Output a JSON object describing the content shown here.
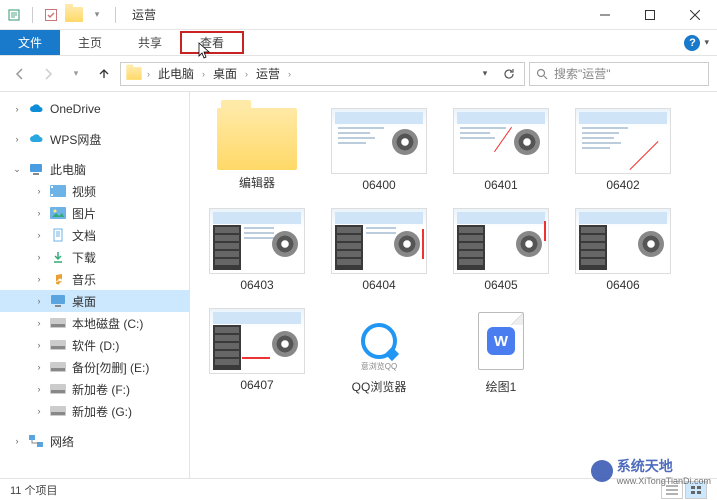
{
  "window": {
    "title": "运营"
  },
  "tabs": {
    "file": "文件",
    "home": "主页",
    "share": "共享",
    "view": "查看"
  },
  "breadcrumb": {
    "root": "此电脑",
    "seg1": "桌面",
    "seg2": "运营"
  },
  "search": {
    "placeholder": "搜索\"运营\""
  },
  "sidebar": {
    "onedrive": "OneDrive",
    "wps": "WPS网盘",
    "thispc": "此电脑",
    "videos": "视频",
    "pictures": "图片",
    "documents": "文档",
    "downloads": "下载",
    "music": "音乐",
    "desktop": "桌面",
    "drive_c": "本地磁盘 (C:)",
    "drive_d": "软件 (D:)",
    "drive_e": "备份[勿删] (E:)",
    "drive_f": "新加卷 (F:)",
    "drive_g": "新加卷 (G:)",
    "network": "网络"
  },
  "items": [
    {
      "name": "编辑器",
      "type": "folder"
    },
    {
      "name": "06400",
      "type": "screenshot"
    },
    {
      "name": "06401",
      "type": "screenshot"
    },
    {
      "name": "06402",
      "type": "screenshot"
    },
    {
      "name": "06403",
      "type": "screenshot_dark"
    },
    {
      "name": "06404",
      "type": "screenshot_dark"
    },
    {
      "name": "06405",
      "type": "screenshot_dark"
    },
    {
      "name": "06406",
      "type": "screenshot_dark"
    },
    {
      "name": "06407",
      "type": "screenshot_dark"
    },
    {
      "name": "QQ浏览器",
      "type": "qq"
    },
    {
      "name": "绘图1",
      "type": "doc"
    }
  ],
  "status": {
    "count": "11 个项目"
  },
  "watermark": {
    "text": "系统天地",
    "sub": "www.XiTongTianDi.com"
  }
}
